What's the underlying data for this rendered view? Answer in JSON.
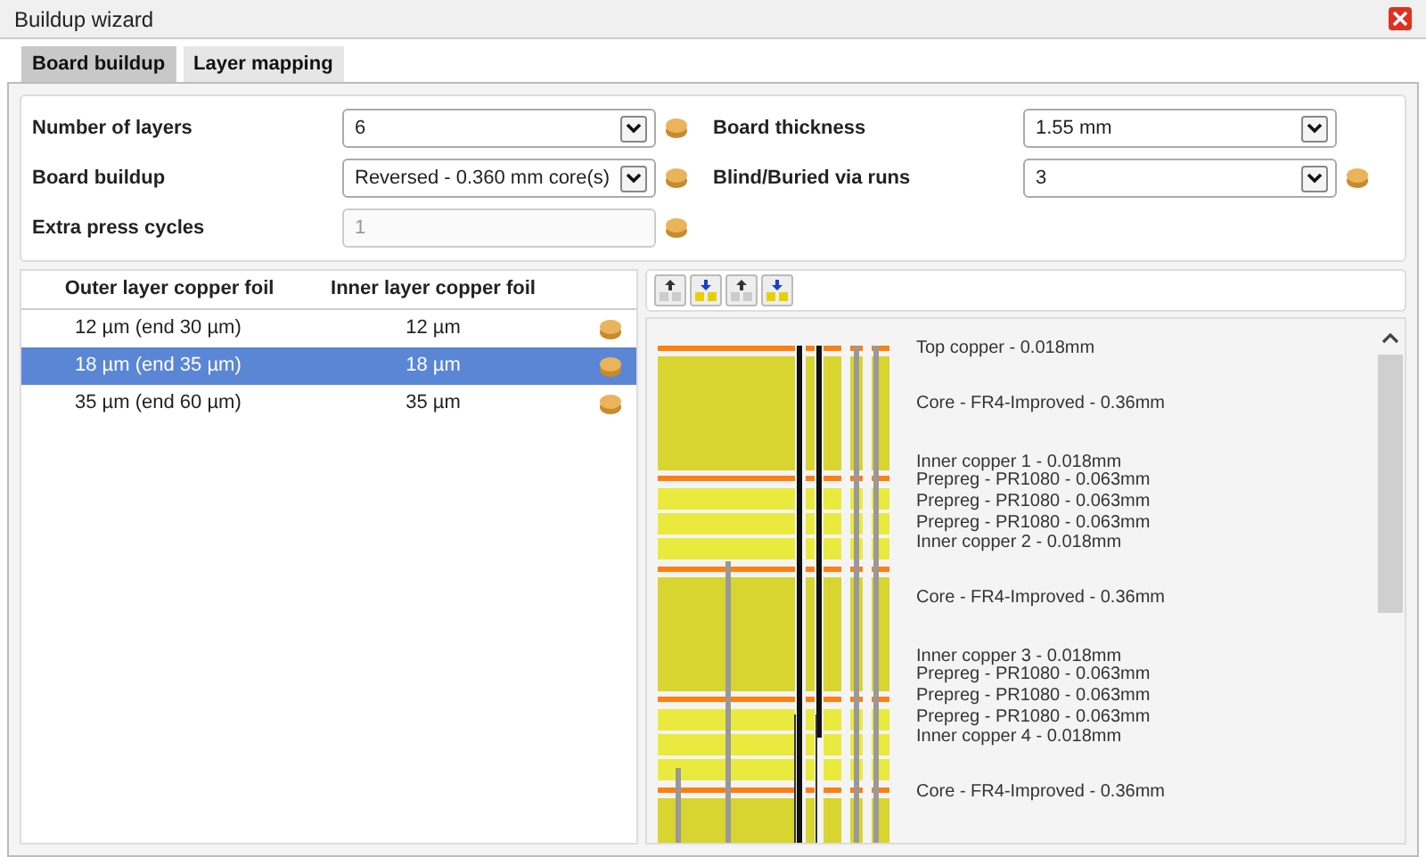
{
  "window": {
    "title": "Buildup wizard"
  },
  "tabs": [
    {
      "label": "Board buildup",
      "selected": true
    },
    {
      "label": "Layer mapping",
      "selected": false
    }
  ],
  "settings": {
    "left": [
      {
        "label": "Number of layers",
        "kind": "dropdown",
        "value": "6",
        "disabled": false,
        "coin": true
      },
      {
        "label": "Board buildup",
        "kind": "dropdown",
        "value": "Reversed - 0.360 mm core(s)",
        "disabled": false,
        "coin": true
      },
      {
        "label": "Extra press cycles",
        "kind": "field",
        "value": "1",
        "disabled": true,
        "coin": true
      }
    ],
    "right": [
      {
        "label": "Board thickness",
        "kind": "dropdown",
        "value": "1.55 mm",
        "disabled": false,
        "coin": false
      },
      {
        "label": "Blind/Buried via runs",
        "kind": "dropdown",
        "value": "3",
        "disabled": false,
        "coin": true
      }
    ]
  },
  "foil_table": {
    "columns": [
      "Outer layer copper foil",
      "Inner layer copper foil"
    ],
    "rows": [
      {
        "outer": "12 µm (end 30 µm)",
        "inner": "12 µm",
        "selected": false
      },
      {
        "outer": "18 µm (end 35 µm)",
        "inner": "18 µm",
        "selected": true
      },
      {
        "outer": "35 µm (end 60 µm)",
        "inner": "35 µm",
        "selected": false
      }
    ]
  },
  "layers": [
    {
      "kind": "copper",
      "label": "Top copper - 0.018mm"
    },
    {
      "kind": "core",
      "label": "Core - FR4-Improved - 0.36mm"
    },
    {
      "kind": "copper",
      "label": "Inner copper 1 - 0.018mm"
    },
    {
      "kind": "prepreg",
      "label": "Prepreg - PR1080 - 0.063mm"
    },
    {
      "kind": "prepreg",
      "label": "Prepreg - PR1080 - 0.063mm"
    },
    {
      "kind": "prepreg",
      "label": "Prepreg - PR1080 - 0.063mm"
    },
    {
      "kind": "copper",
      "label": "Inner copper 2 - 0.018mm"
    },
    {
      "kind": "core",
      "label": "Core - FR4-Improved - 0.36mm"
    },
    {
      "kind": "copper",
      "label": "Inner copper 3 - 0.018mm"
    },
    {
      "kind": "prepreg",
      "label": "Prepreg - PR1080 - 0.063mm"
    },
    {
      "kind": "prepreg",
      "label": "Prepreg - PR1080 - 0.063mm"
    },
    {
      "kind": "prepreg",
      "label": "Prepreg - PR1080 - 0.063mm"
    },
    {
      "kind": "copper",
      "label": "Inner copper 4 - 0.018mm"
    },
    {
      "kind": "core",
      "label": "Core - FR4-Improved - 0.36mm"
    }
  ]
}
